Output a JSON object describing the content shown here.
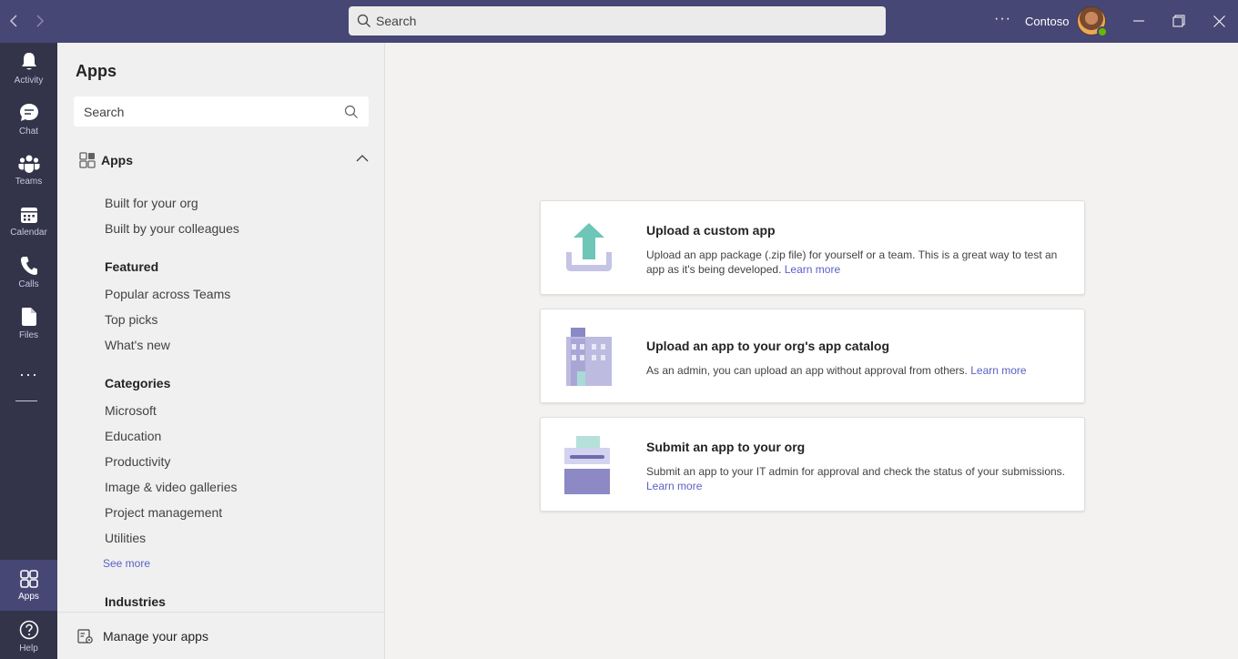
{
  "titlebar": {
    "search_placeholder": "Search",
    "org_name": "Contoso"
  },
  "rail": {
    "items": [
      {
        "label": "Activity",
        "icon": "bell-icon"
      },
      {
        "label": "Chat",
        "icon": "chat-icon"
      },
      {
        "label": "Teams",
        "icon": "teams-icon"
      },
      {
        "label": "Calendar",
        "icon": "calendar-icon"
      },
      {
        "label": "Calls",
        "icon": "phone-icon"
      },
      {
        "label": "Files",
        "icon": "file-icon"
      },
      {
        "label": "Apps",
        "icon": "apps-icon"
      },
      {
        "label": "Help",
        "icon": "help-icon"
      }
    ]
  },
  "leftpane": {
    "title": "Apps",
    "search_placeholder": "Search",
    "section_label": "Apps",
    "org_links": [
      "Built for your org",
      "Built by your colleagues"
    ],
    "featured_heading": "Featured",
    "featured_links": [
      "Popular across Teams",
      "Top picks",
      "What's new"
    ],
    "categories_heading": "Categories",
    "category_links": [
      "Microsoft",
      "Education",
      "Productivity",
      "Image & video galleries",
      "Project management",
      "Utilities"
    ],
    "see_more": "See more",
    "industries_heading": "Industries",
    "manage_label": "Manage your apps"
  },
  "cards": [
    {
      "title": "Upload a custom app",
      "description": "Upload an app package (.zip file) for yourself or a team. This is a great way to test an app as it's being developed.",
      "link": "Learn more"
    },
    {
      "title": "Upload an app to your org's app catalog",
      "description": "As an admin, you can upload an app without approval from others.",
      "link": "Learn more"
    },
    {
      "title": "Submit an app to your org",
      "description": "Submit an app to your IT admin for approval and check the status of your submissions.",
      "link": "Learn more"
    }
  ],
  "colors": {
    "titlebar": "#464775",
    "rail": "#33344a",
    "accent": "#5b5fc7"
  }
}
